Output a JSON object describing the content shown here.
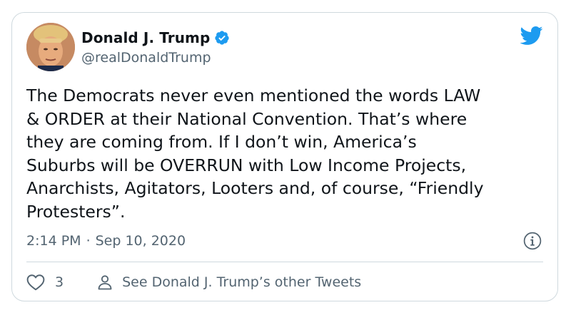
{
  "tweet": {
    "author": {
      "display_name": "Donald J. Trump",
      "handle": "@realDonaldTrump",
      "verified": true,
      "avatar_icon": "avatar-photo"
    },
    "brand_icon": "twitter-bird-icon",
    "text": "The Democrats never even mentioned the words LAW\n& ORDER at their National Convention. That’s where\nthey are coming from. If I don’t win, America’s\nSuburbs will be OVERRUN with Low Income Projects,\nAnarchists, Agitators, Looters and, of course, “Friendly\nProtesters”.",
    "time": "2:14 PM",
    "separator": "·",
    "date": "Sep 10, 2020",
    "likes_count": "3",
    "other_tweets_label": "See Donald J. Trump’s other Tweets"
  },
  "colors": {
    "text_primary": "#0f1419",
    "text_secondary": "#536471",
    "brand_blue": "#1d9bf0",
    "border": "#cfd9de"
  }
}
